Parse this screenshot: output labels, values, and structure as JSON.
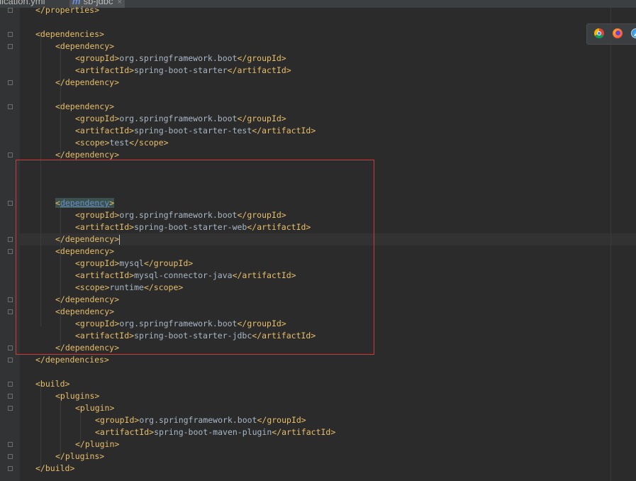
{
  "tabs": [
    {
      "label": "plication.yml",
      "active": false
    },
    {
      "label": "sb-jdbc",
      "prefix": "m",
      "close": "×",
      "active": true
    }
  ],
  "browser_icons": [
    "chrome-icon",
    "firefox-icon",
    "safari-icon"
  ],
  "editor": {
    "highlight_color": "#d13a3a",
    "lines": [
      {
        "indent": 1,
        "parts": [
          {
            "t": "tag",
            "v": "</properties>"
          }
        ]
      },
      {
        "indent": 0,
        "parts": []
      },
      {
        "indent": 1,
        "parts": [
          {
            "t": "tag",
            "v": "<dependencies>"
          }
        ]
      },
      {
        "indent": 2,
        "parts": [
          {
            "t": "tag",
            "v": "<dependency>"
          }
        ]
      },
      {
        "indent": 3,
        "parts": [
          {
            "t": "tag",
            "v": "<groupId>"
          },
          {
            "t": "txt",
            "v": "org.springframework.boot"
          },
          {
            "t": "tag",
            "v": "</groupId>"
          }
        ]
      },
      {
        "indent": 3,
        "parts": [
          {
            "t": "tag",
            "v": "<artifactId>"
          },
          {
            "t": "txt",
            "v": "spring-boot-starter"
          },
          {
            "t": "tag",
            "v": "</artifactId>"
          }
        ]
      },
      {
        "indent": 2,
        "parts": [
          {
            "t": "tag",
            "v": "</dependency>"
          }
        ]
      },
      {
        "indent": 0,
        "parts": []
      },
      {
        "indent": 2,
        "parts": [
          {
            "t": "tag",
            "v": "<dependency>"
          }
        ]
      },
      {
        "indent": 3,
        "parts": [
          {
            "t": "tag",
            "v": "<groupId>"
          },
          {
            "t": "txt",
            "v": "org.springframework.boot"
          },
          {
            "t": "tag",
            "v": "</groupId>"
          }
        ]
      },
      {
        "indent": 3,
        "parts": [
          {
            "t": "tag",
            "v": "<artifactId>"
          },
          {
            "t": "txt",
            "v": "spring-boot-starter-test"
          },
          {
            "t": "tag",
            "v": "</artifactId>"
          }
        ]
      },
      {
        "indent": 3,
        "parts": [
          {
            "t": "tag",
            "v": "<scope>"
          },
          {
            "t": "txt",
            "v": "test"
          },
          {
            "t": "tag",
            "v": "</scope>"
          }
        ]
      },
      {
        "indent": 2,
        "parts": [
          {
            "t": "tag",
            "v": "</dependency>"
          }
        ]
      },
      {
        "indent": 0,
        "parts": []
      },
      {
        "indent": 0,
        "parts": []
      },
      {
        "indent": 0,
        "parts": []
      },
      {
        "indent": 2,
        "parts": [
          {
            "t": "hi",
            "v": "<dependency>"
          }
        ]
      },
      {
        "indent": 3,
        "parts": [
          {
            "t": "tag",
            "v": "<groupId>"
          },
          {
            "t": "txt",
            "v": "org.springframework.boot"
          },
          {
            "t": "tag",
            "v": "</groupId>"
          }
        ]
      },
      {
        "indent": 3,
        "parts": [
          {
            "t": "tag",
            "v": "<artifactId>"
          },
          {
            "t": "txt",
            "v": "spring-boot-starter-web"
          },
          {
            "t": "tag",
            "v": "</artifactId>"
          }
        ]
      },
      {
        "indent": 2,
        "parts": [
          {
            "t": "tag",
            "v": "</dependency>"
          },
          {
            "t": "caret",
            "v": ""
          }
        ]
      },
      {
        "indent": 2,
        "parts": [
          {
            "t": "tag",
            "v": "<dependency>"
          }
        ]
      },
      {
        "indent": 3,
        "parts": [
          {
            "t": "tag",
            "v": "<groupId>"
          },
          {
            "t": "txt",
            "v": "mysql"
          },
          {
            "t": "tag",
            "v": "</groupId>"
          }
        ]
      },
      {
        "indent": 3,
        "parts": [
          {
            "t": "tag",
            "v": "<artifactId>"
          },
          {
            "t": "txt",
            "v": "mysql-connector-java"
          },
          {
            "t": "tag",
            "v": "</artifactId>"
          }
        ]
      },
      {
        "indent": 3,
        "parts": [
          {
            "t": "tag",
            "v": "<scope>"
          },
          {
            "t": "txt",
            "v": "runtime"
          },
          {
            "t": "tag",
            "v": "</scope>"
          }
        ]
      },
      {
        "indent": 2,
        "parts": [
          {
            "t": "tag",
            "v": "</dependency>"
          }
        ]
      },
      {
        "indent": 2,
        "parts": [
          {
            "t": "tag",
            "v": "<dependency>"
          }
        ]
      },
      {
        "indent": 3,
        "parts": [
          {
            "t": "tag",
            "v": "<groupId>"
          },
          {
            "t": "txt",
            "v": "org.springframework.boot"
          },
          {
            "t": "tag",
            "v": "</groupId>"
          }
        ]
      },
      {
        "indent": 3,
        "parts": [
          {
            "t": "tag",
            "v": "<artifactId>"
          },
          {
            "t": "txt",
            "v": "spring-boot-starter-jdbc"
          },
          {
            "t": "tag",
            "v": "</artifactId>"
          }
        ]
      },
      {
        "indent": 2,
        "parts": [
          {
            "t": "tag",
            "v": "</dependency>"
          }
        ]
      },
      {
        "indent": 1,
        "parts": [
          {
            "t": "tag",
            "v": "</dependencies>"
          }
        ]
      },
      {
        "indent": 0,
        "parts": []
      },
      {
        "indent": 1,
        "parts": [
          {
            "t": "tag",
            "v": "<build>"
          }
        ]
      },
      {
        "indent": 2,
        "parts": [
          {
            "t": "tag",
            "v": "<plugins>"
          }
        ]
      },
      {
        "indent": 3,
        "parts": [
          {
            "t": "tag",
            "v": "<plugin>"
          }
        ]
      },
      {
        "indent": 4,
        "parts": [
          {
            "t": "tag",
            "v": "<groupId>"
          },
          {
            "t": "txt",
            "v": "org.springframework.boot"
          },
          {
            "t": "tag",
            "v": "</groupId>"
          }
        ]
      },
      {
        "indent": 4,
        "parts": [
          {
            "t": "tag",
            "v": "<artifactId>"
          },
          {
            "t": "txt",
            "v": "spring-boot-maven-plugin"
          },
          {
            "t": "tag",
            "v": "</artifactId>"
          }
        ]
      },
      {
        "indent": 3,
        "parts": [
          {
            "t": "tag",
            "v": "</plugin>"
          }
        ]
      },
      {
        "indent": 2,
        "parts": [
          {
            "t": "tag",
            "v": "</plugins>"
          }
        ]
      },
      {
        "indent": 1,
        "parts": [
          {
            "t": "tag",
            "v": "</build>"
          }
        ]
      }
    ]
  }
}
